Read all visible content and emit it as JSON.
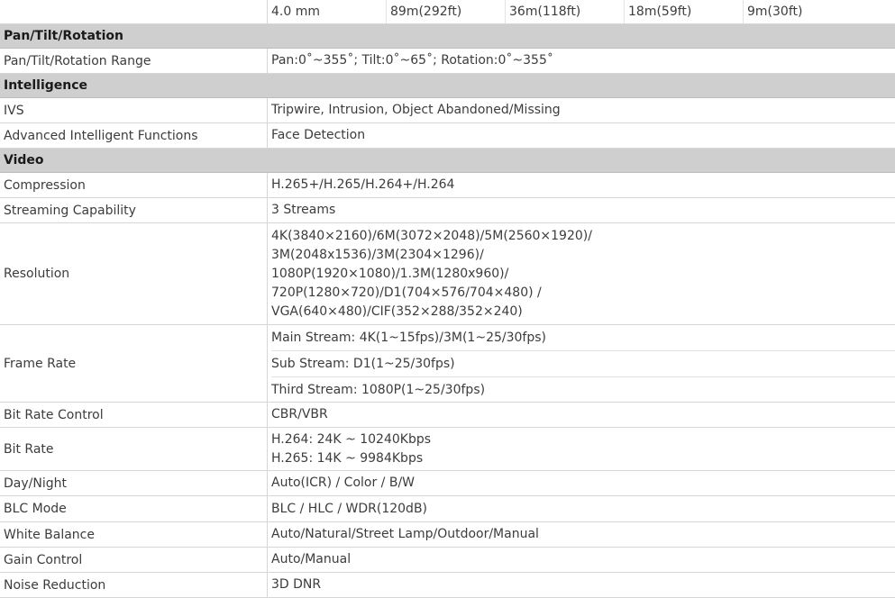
{
  "lens_row": [
    "4.0 mm",
    "89m(292ft)",
    "36m(118ft)",
    "18m(59ft)",
    "9m(30ft)"
  ],
  "sections": {
    "ptz": "Pan/Tilt/Rotation",
    "intelligence": "Intelligence",
    "video": "Video"
  },
  "rows": {
    "ptz_range": {
      "label": "Pan/Tilt/Rotation Range",
      "value": "Pan:0˚~355˚; Tilt:0˚~65˚; Rotation:0˚~355˚"
    },
    "ivs": {
      "label": "IVS",
      "value": "Tripwire, Intrusion, Object Abandoned/Missing"
    },
    "aif": {
      "label": "Advanced Intelligent Functions",
      "value": "Face Detection"
    },
    "compression": {
      "label": "Compression",
      "value": "H.265+/H.265/H.264+/H.264"
    },
    "streaming": {
      "label": "Streaming Capability",
      "value": "3 Streams"
    },
    "resolution": {
      "label": "Resolution",
      "lines": [
        "4K(3840×2160)/6M(3072×2048)/5M(2560×1920)/",
        "3M(2048x1536)/3M(2304×1296)/",
        "1080P(1920×1080)/1.3M(1280x960)/",
        "720P(1280×720)/D1(704×576/704×480) /",
        "VGA(640×480)/CIF(352×288/352×240)"
      ]
    },
    "frame_rate": {
      "label": "Frame Rate",
      "lines": [
        "Main Stream: 4K(1~15fps)/3M(1~25/30fps)",
        "Sub Stream: D1(1~25/30fps)",
        "Third Stream: 1080P(1~25/30fps)"
      ]
    },
    "bitrate_control": {
      "label": "Bit Rate Control",
      "value": "CBR/VBR"
    },
    "bitrate": {
      "label": "Bit Rate",
      "lines": [
        "H.264: 24K ~ 10240Kbps",
        "H.265: 14K ~ 9984Kbps"
      ]
    },
    "daynight": {
      "label": "Day/Night",
      "value": "Auto(ICR) / Color / B/W"
    },
    "blc": {
      "label": "BLC Mode",
      "value": "BLC / HLC / WDR(120dB)"
    },
    "wb": {
      "label": "White Balance",
      "value": "Auto/Natural/Street Lamp/Outdoor/Manual"
    },
    "gain": {
      "label": "Gain Control",
      "value": "Auto/Manual"
    },
    "noise": {
      "label": "Noise Reduction",
      "value": "3D DNR"
    }
  }
}
